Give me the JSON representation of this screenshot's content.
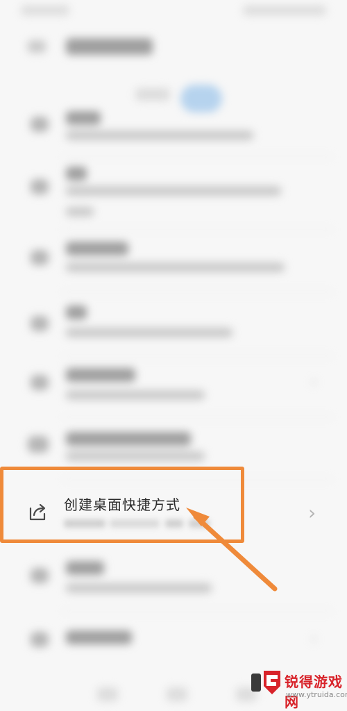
{
  "focused_item": {
    "title": "创建桌面快捷方式",
    "icon": "share-out-icon",
    "chevron": "›"
  },
  "watermark": {
    "brand": "锐得游戏网",
    "url": "www.ytruida.com"
  },
  "colors": {
    "highlight": "#ef8a3a",
    "brand": "#d8232a"
  }
}
